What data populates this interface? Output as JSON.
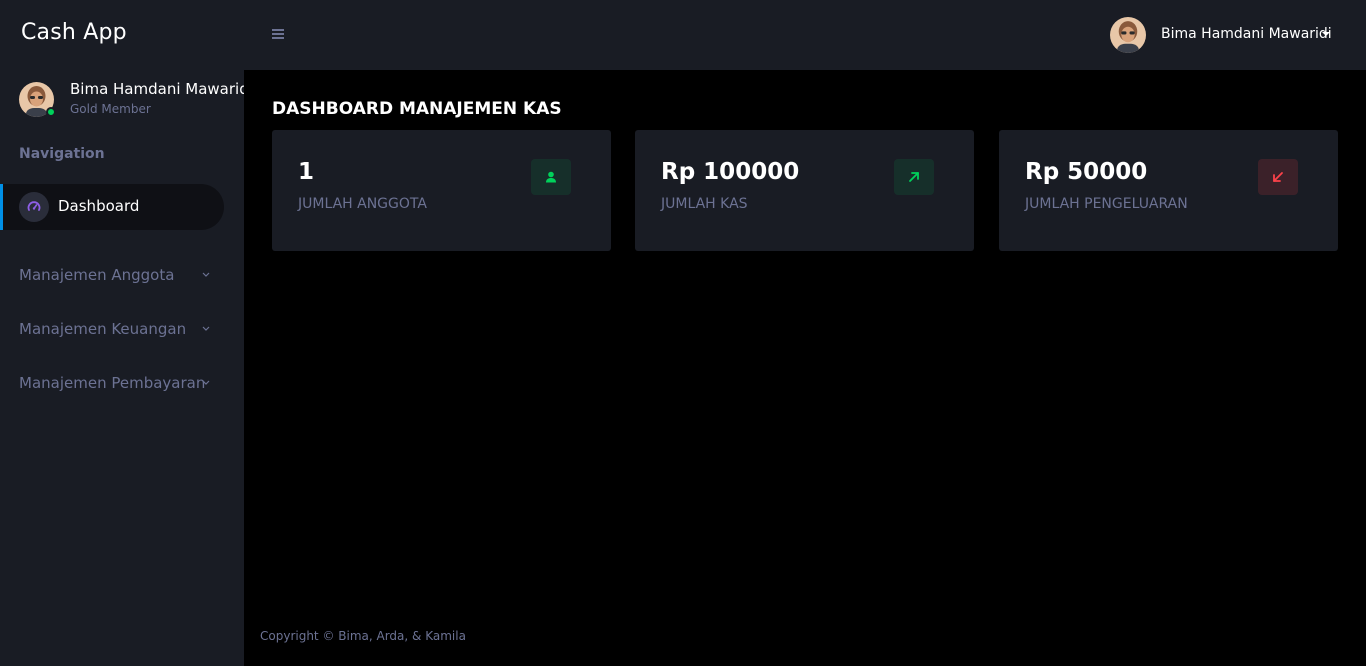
{
  "app": {
    "brand": "Cash App"
  },
  "sidebar": {
    "profile": {
      "name": "Bima Hamdani Mawaridi",
      "role": "Gold Member"
    },
    "nav_caption": "Navigation",
    "items": [
      {
        "label": "Dashboard",
        "active": true
      },
      {
        "label": "Manajemen Anggota"
      },
      {
        "label": "Manajemen Keuangan"
      },
      {
        "label": "Manajemen Pembayaran"
      }
    ]
  },
  "topbar": {
    "user_name": "Bima Hamdani Mawaridi"
  },
  "main": {
    "title": "DASHBOARD MANAJEMEN KAS",
    "cards": [
      {
        "value": "1",
        "label": "JUMLAH ANGGOTA",
        "icon": "user-icon",
        "icon_color": "#00d25b"
      },
      {
        "value": "Rp 100000",
        "label": "JUMLAH KAS",
        "icon": "arrow-up-right-icon",
        "icon_color": "#00d25b"
      },
      {
        "value": "Rp 50000",
        "label": "JUMLAH PENGELUARAN",
        "icon": "arrow-down-left-icon",
        "icon_color": "#fc424a"
      }
    ]
  },
  "footer": {
    "copyright": "Copyright © Bima, Arda, & Kamila"
  },
  "colors": {
    "sidebar_bg": "#191c24",
    "content_bg": "#000000",
    "muted_text": "#6c7293",
    "accent_blue": "#0090e7",
    "success": "#00d25b",
    "danger": "#fc424a",
    "nav_icon_purple": "#8f5fe8"
  }
}
